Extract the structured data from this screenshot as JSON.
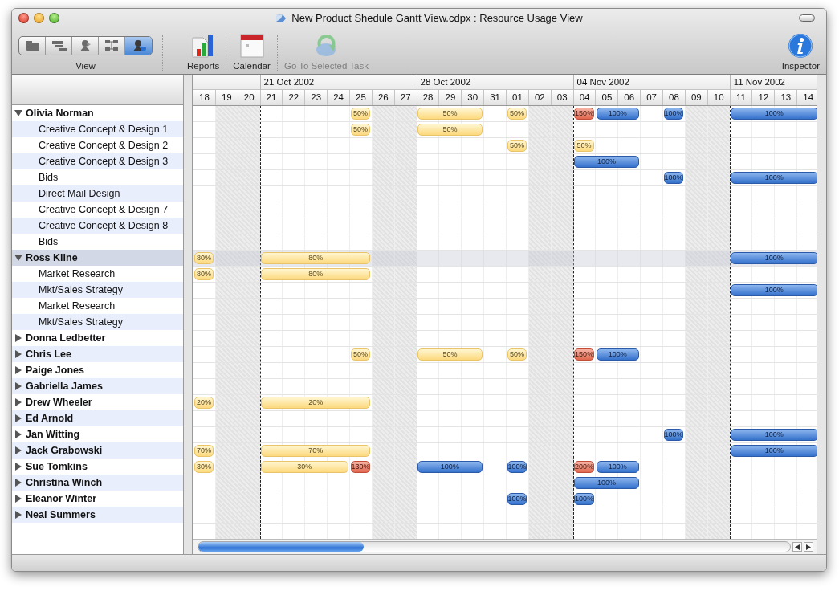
{
  "window": {
    "title": "New Product Shedule Gantt View.cdpx : Resource Usage View"
  },
  "toolbar": {
    "view": {
      "label": "View",
      "segments": [
        {
          "kind": "folder",
          "selected": false
        },
        {
          "kind": "bars",
          "selected": false
        },
        {
          "kind": "person",
          "selected": false
        },
        {
          "kind": "network",
          "selected": false
        },
        {
          "kind": "resource",
          "selected": true
        }
      ]
    },
    "items": [
      {
        "kind": "reports",
        "label": "Reports",
        "disabled": false
      },
      {
        "kind": "calendar",
        "label": "Calendar",
        "disabled": false
      },
      {
        "kind": "goto",
        "label": "Go To Selected Task",
        "disabled": true
      }
    ],
    "inspector": {
      "label": "Inspector"
    }
  },
  "timeline": {
    "weeks": [
      {
        "days": [
          {
            "label": "18",
            "weekend": false
          },
          {
            "label": "19",
            "weekend": true
          },
          {
            "label": "20",
            "weekend": true
          }
        ]
      },
      {
        "label": "21 Oct 2002",
        "days": [
          {
            "label": "21",
            "weekend": false
          },
          {
            "label": "22",
            "weekend": false
          },
          {
            "label": "23",
            "weekend": false
          },
          {
            "label": "24",
            "weekend": false
          },
          {
            "label": "25",
            "weekend": false
          },
          {
            "label": "26",
            "weekend": true
          },
          {
            "label": "27",
            "weekend": true
          }
        ]
      },
      {
        "label": "28 Oct 2002",
        "days": [
          {
            "label": "28",
            "weekend": false
          },
          {
            "label": "29",
            "weekend": false
          },
          {
            "label": "30",
            "weekend": false
          },
          {
            "label": "31",
            "weekend": false
          },
          {
            "label": "01",
            "weekend": false
          },
          {
            "label": "02",
            "weekend": true
          },
          {
            "label": "03",
            "weekend": true
          }
        ]
      },
      {
        "label": "04 Nov 2002",
        "days": [
          {
            "label": "04",
            "weekend": false
          },
          {
            "label": "05",
            "weekend": false
          },
          {
            "label": "06",
            "weekend": false
          },
          {
            "label": "07",
            "weekend": false
          },
          {
            "label": "08",
            "weekend": false
          },
          {
            "label": "09",
            "weekend": true
          },
          {
            "label": "10",
            "weekend": true
          }
        ]
      },
      {
        "label": "11 Nov 2002",
        "days": [
          {
            "label": "11",
            "weekend": false
          },
          {
            "label": "12",
            "weekend": false
          },
          {
            "label": "13",
            "weekend": false
          },
          {
            "label": "14",
            "weekend": false
          }
        ]
      }
    ]
  },
  "resources": [
    {
      "name": "Olivia Norman",
      "expanded": true,
      "selected": false,
      "cells": [
        {
          "kind": "empty"
        },
        {
          "kind": "empty"
        },
        {
          "kind": "empty"
        },
        {
          "kind": "empty"
        },
        {
          "kind": "empty"
        },
        {
          "kind": "empty"
        },
        {
          "kind": "empty"
        },
        {
          "kind": "partial",
          "label": "50%"
        },
        {
          "kind": "empty"
        },
        {
          "kind": "empty"
        },
        {
          "kind": "partial",
          "label": "50%"
        },
        {
          "kind": "partial"
        },
        {
          "kind": "partial"
        },
        {
          "kind": "empty"
        },
        {
          "kind": "partial",
          "label": "50%"
        },
        {
          "kind": "empty"
        },
        {
          "kind": "empty"
        },
        {
          "kind": "over",
          "label": "150%"
        },
        {
          "kind": "full",
          "label": "100%"
        },
        {
          "kind": "full"
        },
        {
          "kind": "empty"
        },
        {
          "kind": "full",
          "label": "100%"
        },
        {
          "kind": "empty"
        },
        {
          "kind": "empty"
        },
        {
          "kind": "full",
          "label": "100%"
        },
        {
          "kind": "full"
        },
        {
          "kind": "full"
        },
        {
          "kind": "full"
        }
      ],
      "children": [
        {
          "name": "Creative Concept & Design 1",
          "selected": false,
          "cells": [
            {
              "kind": "empty"
            },
            {
              "kind": "empty"
            },
            {
              "kind": "empty"
            },
            {
              "kind": "empty"
            },
            {
              "kind": "empty"
            },
            {
              "kind": "empty"
            },
            {
              "kind": "empty"
            },
            {
              "kind": "partial",
              "label": "50%"
            },
            {
              "kind": "empty"
            },
            {
              "kind": "empty"
            },
            {
              "kind": "partial",
              "label": "50%"
            },
            {
              "kind": "partial"
            },
            {
              "kind": "partial"
            }
          ]
        },
        {
          "name": "Creative Concept & Design 2",
          "selected": false,
          "cells": [
            {
              "kind": "empty"
            },
            {
              "kind": "empty"
            },
            {
              "kind": "empty"
            },
            {
              "kind": "empty"
            },
            {
              "kind": "empty"
            },
            {
              "kind": "empty"
            },
            {
              "kind": "empty"
            },
            {
              "kind": "empty"
            },
            {
              "kind": "empty"
            },
            {
              "kind": "empty"
            },
            {
              "kind": "empty"
            },
            {
              "kind": "empty"
            },
            {
              "kind": "empty"
            },
            {
              "kind": "empty"
            },
            {
              "kind": "partial",
              "label": "50%"
            },
            {
              "kind": "empty"
            },
            {
              "kind": "empty"
            },
            {
              "kind": "partial",
              "label": "50%"
            }
          ]
        },
        {
          "name": "Creative Concept & Design 3",
          "selected": false,
          "cells": [
            {
              "kind": "empty"
            },
            {
              "kind": "empty"
            },
            {
              "kind": "empty"
            },
            {
              "kind": "empty"
            },
            {
              "kind": "empty"
            },
            {
              "kind": "empty"
            },
            {
              "kind": "empty"
            },
            {
              "kind": "empty"
            },
            {
              "kind": "empty"
            },
            {
              "kind": "empty"
            },
            {
              "kind": "empty"
            },
            {
              "kind": "empty"
            },
            {
              "kind": "empty"
            },
            {
              "kind": "empty"
            },
            {
              "kind": "empty"
            },
            {
              "kind": "empty"
            },
            {
              "kind": "empty"
            },
            {
              "kind": "full",
              "label": "100%"
            },
            {
              "kind": "full"
            },
            {
              "kind": "full"
            }
          ]
        },
        {
          "name": "Bids",
          "selected": false,
          "cells": [
            {
              "kind": "empty"
            },
            {
              "kind": "empty"
            },
            {
              "kind": "empty"
            },
            {
              "kind": "empty"
            },
            {
              "kind": "empty"
            },
            {
              "kind": "empty"
            },
            {
              "kind": "empty"
            },
            {
              "kind": "empty"
            },
            {
              "kind": "empty"
            },
            {
              "kind": "empty"
            },
            {
              "kind": "empty"
            },
            {
              "kind": "empty"
            },
            {
              "kind": "empty"
            },
            {
              "kind": "empty"
            },
            {
              "kind": "empty"
            },
            {
              "kind": "empty"
            },
            {
              "kind": "empty"
            },
            {
              "kind": "empty"
            },
            {
              "kind": "empty"
            },
            {
              "kind": "empty"
            },
            {
              "kind": "empty"
            },
            {
              "kind": "full",
              "label": "100%"
            },
            {
              "kind": "empty"
            },
            {
              "kind": "empty"
            },
            {
              "kind": "full",
              "label": "100%"
            },
            {
              "kind": "full"
            },
            {
              "kind": "full"
            },
            {
              "kind": "full"
            }
          ]
        },
        {
          "name": "Direct Mail Design",
          "selected": false
        },
        {
          "name": "Creative Concept & Design 7",
          "selected": false
        },
        {
          "name": "Creative Concept & Design 8",
          "selected": false
        },
        {
          "name": "Bids",
          "selected": false
        }
      ]
    },
    {
      "name": "Ross Kline",
      "expanded": true,
      "selected": true,
      "cells": [
        {
          "kind": "partial",
          "label": "80%"
        },
        {
          "kind": "empty"
        },
        {
          "kind": "empty"
        },
        {
          "kind": "partial",
          "label": "80%"
        },
        {
          "kind": "partial"
        },
        {
          "kind": "partial"
        },
        {
          "kind": "partial"
        },
        {
          "kind": "partial"
        },
        {
          "kind": "empty"
        },
        {
          "kind": "empty"
        },
        {
          "kind": "empty"
        },
        {
          "kind": "empty"
        },
        {
          "kind": "empty"
        },
        {
          "kind": "empty"
        },
        {
          "kind": "empty"
        },
        {
          "kind": "empty"
        },
        {
          "kind": "empty"
        },
        {
          "kind": "empty"
        },
        {
          "kind": "empty"
        },
        {
          "kind": "empty"
        },
        {
          "kind": "empty"
        },
        {
          "kind": "empty"
        },
        {
          "kind": "empty"
        },
        {
          "kind": "empty"
        },
        {
          "kind": "full",
          "label": "100%"
        },
        {
          "kind": "full"
        },
        {
          "kind": "full"
        },
        {
          "kind": "full"
        }
      ],
      "children": [
        {
          "name": "Market Research",
          "selected": false,
          "cells": [
            {
              "kind": "partial",
              "label": "80%"
            },
            {
              "kind": "empty"
            },
            {
              "kind": "empty"
            },
            {
              "kind": "partial",
              "label": "80%"
            },
            {
              "kind": "partial"
            },
            {
              "kind": "partial"
            },
            {
              "kind": "partial"
            },
            {
              "kind": "partial"
            }
          ]
        },
        {
          "name": "Mkt/Sales Strategy",
          "selected": false,
          "cells": [
            {
              "kind": "empty"
            },
            {
              "kind": "empty"
            },
            {
              "kind": "empty"
            },
            {
              "kind": "empty"
            },
            {
              "kind": "empty"
            },
            {
              "kind": "empty"
            },
            {
              "kind": "empty"
            },
            {
              "kind": "empty"
            },
            {
              "kind": "empty"
            },
            {
              "kind": "empty"
            },
            {
              "kind": "empty"
            },
            {
              "kind": "empty"
            },
            {
              "kind": "empty"
            },
            {
              "kind": "empty"
            },
            {
              "kind": "empty"
            },
            {
              "kind": "empty"
            },
            {
              "kind": "empty"
            },
            {
              "kind": "empty"
            },
            {
              "kind": "empty"
            },
            {
              "kind": "empty"
            },
            {
              "kind": "empty"
            },
            {
              "kind": "empty"
            },
            {
              "kind": "empty"
            },
            {
              "kind": "empty"
            },
            {
              "kind": "full",
              "label": "100%"
            },
            {
              "kind": "full"
            },
            {
              "kind": "full"
            },
            {
              "kind": "full"
            }
          ]
        },
        {
          "name": "Market Research",
          "selected": false
        },
        {
          "name": "Mkt/Sales Strategy",
          "selected": false
        }
      ]
    },
    {
      "name": "Donna Ledbetter",
      "expanded": false,
      "selected": false
    },
    {
      "name": "Chris Lee",
      "expanded": false,
      "selected": false,
      "cells": [
        {
          "kind": "empty"
        },
        {
          "kind": "empty"
        },
        {
          "kind": "empty"
        },
        {
          "kind": "empty"
        },
        {
          "kind": "empty"
        },
        {
          "kind": "empty"
        },
        {
          "kind": "empty"
        },
        {
          "kind": "partial",
          "label": "50%"
        },
        {
          "kind": "empty"
        },
        {
          "kind": "empty"
        },
        {
          "kind": "partial",
          "label": "50%"
        },
        {
          "kind": "partial"
        },
        {
          "kind": "partial"
        },
        {
          "kind": "empty"
        },
        {
          "kind": "partial",
          "label": "50%"
        },
        {
          "kind": "empty"
        },
        {
          "kind": "empty"
        },
        {
          "kind": "over",
          "label": "150%"
        },
        {
          "kind": "full",
          "label": "100%"
        },
        {
          "kind": "full"
        }
      ]
    },
    {
      "name": "Paige Jones",
      "expanded": false,
      "selected": false
    },
    {
      "name": "Gabriella  James",
      "expanded": false,
      "selected": false
    },
    {
      "name": "Drew Wheeler",
      "expanded": false,
      "selected": false,
      "cells": [
        {
          "kind": "partial",
          "label": "20%"
        },
        {
          "kind": "empty"
        },
        {
          "kind": "empty"
        },
        {
          "kind": "partial",
          "label": "20%"
        },
        {
          "kind": "partial"
        },
        {
          "kind": "partial"
        },
        {
          "kind": "partial"
        },
        {
          "kind": "partial"
        }
      ]
    },
    {
      "name": "Ed Arnold",
      "expanded": false,
      "selected": false
    },
    {
      "name": "Jan Witting",
      "expanded": false,
      "selected": false,
      "cells": [
        {
          "kind": "empty"
        },
        {
          "kind": "empty"
        },
        {
          "kind": "empty"
        },
        {
          "kind": "empty"
        },
        {
          "kind": "empty"
        },
        {
          "kind": "empty"
        },
        {
          "kind": "empty"
        },
        {
          "kind": "empty"
        },
        {
          "kind": "empty"
        },
        {
          "kind": "empty"
        },
        {
          "kind": "empty"
        },
        {
          "kind": "empty"
        },
        {
          "kind": "empty"
        },
        {
          "kind": "empty"
        },
        {
          "kind": "empty"
        },
        {
          "kind": "empty"
        },
        {
          "kind": "empty"
        },
        {
          "kind": "empty"
        },
        {
          "kind": "empty"
        },
        {
          "kind": "empty"
        },
        {
          "kind": "empty"
        },
        {
          "kind": "full",
          "label": "100%"
        },
        {
          "kind": "empty"
        },
        {
          "kind": "empty"
        },
        {
          "kind": "full",
          "label": "100%"
        },
        {
          "kind": "full"
        },
        {
          "kind": "full"
        },
        {
          "kind": "full"
        }
      ]
    },
    {
      "name": "Jack Grabowski",
      "expanded": false,
      "selected": false,
      "cells": [
        {
          "kind": "partial",
          "label": "70%"
        },
        {
          "kind": "empty"
        },
        {
          "kind": "empty"
        },
        {
          "kind": "partial",
          "label": "70%"
        },
        {
          "kind": "partial"
        },
        {
          "kind": "partial"
        },
        {
          "kind": "partial"
        },
        {
          "kind": "partial"
        },
        {
          "kind": "empty"
        },
        {
          "kind": "empty"
        },
        {
          "kind": "empty"
        },
        {
          "kind": "empty"
        },
        {
          "kind": "empty"
        },
        {
          "kind": "empty"
        },
        {
          "kind": "empty"
        },
        {
          "kind": "empty"
        },
        {
          "kind": "empty"
        },
        {
          "kind": "empty"
        },
        {
          "kind": "empty"
        },
        {
          "kind": "empty"
        },
        {
          "kind": "empty"
        },
        {
          "kind": "empty"
        },
        {
          "kind": "empty"
        },
        {
          "kind": "empty"
        },
        {
          "kind": "full",
          "label": "100%"
        },
        {
          "kind": "full"
        },
        {
          "kind": "full"
        },
        {
          "kind": "full"
        }
      ]
    },
    {
      "name": "Sue Tomkins",
      "expanded": false,
      "selected": false,
      "cells": [
        {
          "kind": "partial",
          "label": "30%"
        },
        {
          "kind": "empty"
        },
        {
          "kind": "empty"
        },
        {
          "kind": "partial",
          "label": "30%"
        },
        {
          "kind": "partial"
        },
        {
          "kind": "partial"
        },
        {
          "kind": "partial"
        },
        {
          "kind": "over",
          "label": "130%"
        },
        {
          "kind": "empty"
        },
        {
          "kind": "empty"
        },
        {
          "kind": "full",
          "label": "100%"
        },
        {
          "kind": "full"
        },
        {
          "kind": "full"
        },
        {
          "kind": "empty"
        },
        {
          "kind": "full",
          "label": "100%"
        },
        {
          "kind": "empty"
        },
        {
          "kind": "empty"
        },
        {
          "kind": "over",
          "label": "200%"
        },
        {
          "kind": "full",
          "label": "100%"
        },
        {
          "kind": "full"
        }
      ]
    },
    {
      "name": "Christina Winch",
      "expanded": false,
      "selected": false,
      "cells": [
        {
          "kind": "empty"
        },
        {
          "kind": "empty"
        },
        {
          "kind": "empty"
        },
        {
          "kind": "empty"
        },
        {
          "kind": "empty"
        },
        {
          "kind": "empty"
        },
        {
          "kind": "empty"
        },
        {
          "kind": "empty"
        },
        {
          "kind": "empty"
        },
        {
          "kind": "empty"
        },
        {
          "kind": "empty"
        },
        {
          "kind": "empty"
        },
        {
          "kind": "empty"
        },
        {
          "kind": "empty"
        },
        {
          "kind": "empty"
        },
        {
          "kind": "empty"
        },
        {
          "kind": "empty"
        },
        {
          "kind": "full",
          "label": "100%"
        },
        {
          "kind": "full"
        },
        {
          "kind": "full"
        }
      ]
    },
    {
      "name": "Eleanor Winter",
      "expanded": false,
      "selected": false,
      "cells": [
        {
          "kind": "empty"
        },
        {
          "kind": "empty"
        },
        {
          "kind": "empty"
        },
        {
          "kind": "empty"
        },
        {
          "kind": "empty"
        },
        {
          "kind": "empty"
        },
        {
          "kind": "empty"
        },
        {
          "kind": "empty"
        },
        {
          "kind": "empty"
        },
        {
          "kind": "empty"
        },
        {
          "kind": "empty"
        },
        {
          "kind": "empty"
        },
        {
          "kind": "empty"
        },
        {
          "kind": "empty"
        },
        {
          "kind": "full",
          "label": "100%"
        },
        {
          "kind": "empty"
        },
        {
          "kind": "empty"
        },
        {
          "kind": "full",
          "label": "100%"
        }
      ]
    },
    {
      "name": "Neal Summers",
      "expanded": false,
      "selected": false
    }
  ]
}
